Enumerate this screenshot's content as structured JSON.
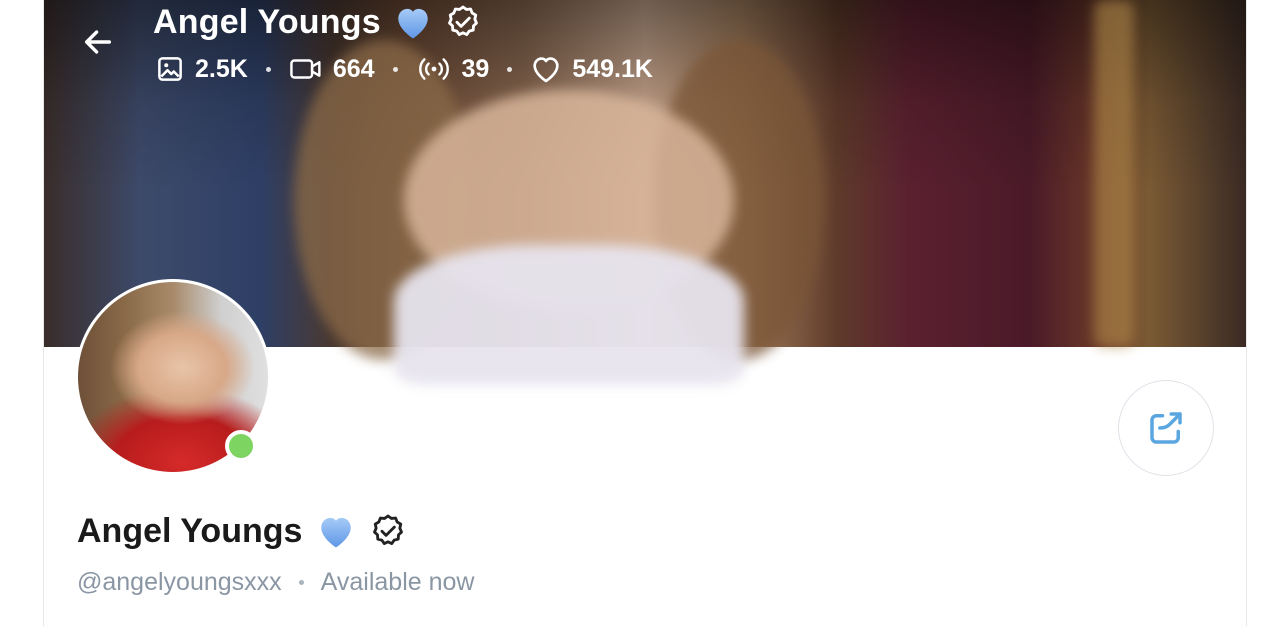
{
  "header": {
    "name": "Angel Youngs",
    "stats": {
      "photos": "2.5K",
      "videos": "664",
      "streams": "39",
      "likes": "549.1K"
    }
  },
  "profile": {
    "name": "Angel Youngs",
    "username": "@angelyoungsxxx",
    "status": "Available now",
    "online": true
  },
  "icons": {
    "back": "arrow-left-icon",
    "heart_emoji": "blue-heart-icon",
    "verified": "verified-badge-icon",
    "photos": "image-icon",
    "videos": "video-icon",
    "streams": "broadcast-icon",
    "likes": "heart-outline-icon",
    "share": "share-icon"
  },
  "colors": {
    "accent": "#00aff0",
    "share_icon": "#5aa6e0",
    "online": "#7ed461",
    "muted_text": "#8a96a3",
    "blue_heart": "#7fb2f0"
  }
}
